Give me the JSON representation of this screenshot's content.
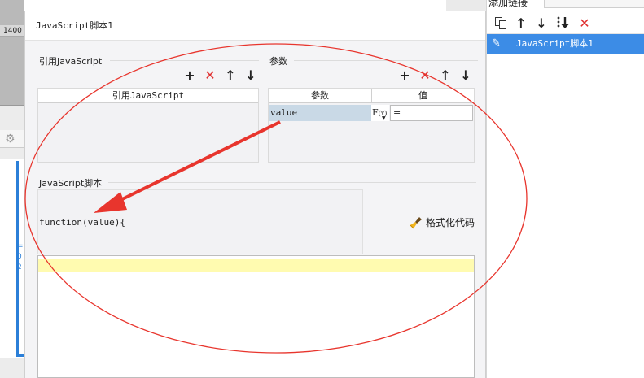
{
  "background_app": {
    "ruler_value": "1400",
    "ticks": [
      "=",
      "0",
      "2"
    ]
  },
  "dialog": {
    "title": "JavaScript脚本1",
    "referenced_js": {
      "label": "引用JavaScript",
      "column_header": "引用JavaScript",
      "toolbar": [
        "add-icon",
        "delete-icon",
        "move-up-icon",
        "move-down-icon"
      ]
    },
    "params": {
      "label": "参数",
      "columns": [
        "参数",
        "值"
      ],
      "toolbar": [
        "add-icon",
        "delete-icon",
        "move-up-icon",
        "move-down-icon"
      ],
      "rows": [
        {
          "name": "value",
          "formula_button": "F(x)",
          "value": "="
        }
      ]
    },
    "script": {
      "label": "JavaScript脚本",
      "signature": "function(value){",
      "format_button": "格式化代码",
      "code": ""
    }
  },
  "right_panel": {
    "top_tab": "添加链接",
    "toolbar": [
      "copy-icon",
      "move-up-icon",
      "move-down-icon",
      "sort-icon",
      "delete-icon"
    ],
    "items": [
      {
        "label": "JavaScript脚本1",
        "selected": true
      }
    ]
  },
  "colors": {
    "selection_blue": "#3c8ce6",
    "annotation_red": "#e8352d",
    "editor_highlight": "#fffbb0",
    "param_name_bg": "#c9d9e6"
  }
}
